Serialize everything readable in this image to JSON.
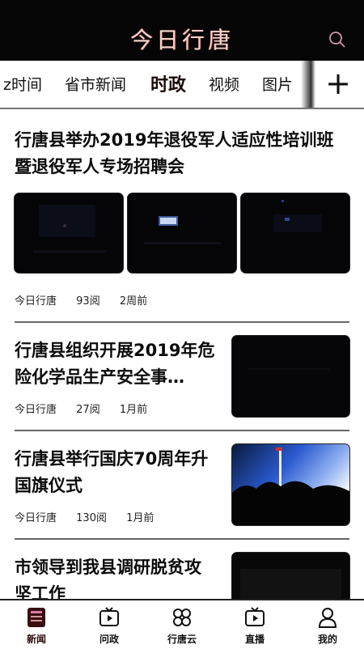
{
  "header": {
    "title": "今日行唐",
    "search_icon": "search-icon"
  },
  "tabs": [
    {
      "label": "z时间"
    },
    {
      "label": "省市新闻"
    },
    {
      "label": "时政",
      "active": true
    },
    {
      "label": "视频"
    },
    {
      "label": "图片"
    }
  ],
  "add_channel_label": "+",
  "articles": [
    {
      "headline": "行唐县举办2019年退役军人适应性培训班暨退役军人专场招聘会",
      "source": "今日行唐",
      "reads": "93阅",
      "time": "2周前"
    },
    {
      "headline": "行唐县组织开展2019年危险化学品生产安全事…",
      "source": "今日行唐",
      "reads": "27阅",
      "time": "1月前"
    },
    {
      "headline": "行唐县举行国庆70周年升国旗仪式",
      "source": "今日行唐",
      "reads": "130阅",
      "time": "1月前"
    },
    {
      "headline": "市领导到我县调研脱贫攻坚工作",
      "source": "",
      "reads": "",
      "time": ""
    }
  ],
  "bottom_nav": [
    {
      "label": "新闻",
      "icon": "newspaper-icon",
      "active": true
    },
    {
      "label": "问政",
      "icon": "tv-icon"
    },
    {
      "label": "行唐云",
      "icon": "cloud-clover-icon"
    },
    {
      "label": "直播",
      "icon": "live-tv-icon"
    },
    {
      "label": "我的",
      "icon": "user-icon"
    }
  ],
  "colors": {
    "header_bg": "#050505",
    "title": "#e9d7cf",
    "text": "#111111"
  }
}
